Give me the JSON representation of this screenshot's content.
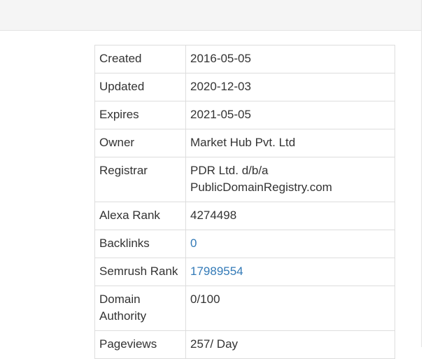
{
  "whois": {
    "rows": [
      {
        "label": "Created",
        "value": "2016-05-05"
      },
      {
        "label": "Updated",
        "value": "2020-12-03"
      },
      {
        "label": "Expires",
        "value": "2021-05-05"
      },
      {
        "label": "Owner",
        "value": "Market Hub Pvt. Ltd"
      },
      {
        "label": "Registrar",
        "value": "PDR Ltd. d/b/a PublicDomainRegistry.com"
      },
      {
        "label": "Alexa Rank",
        "value": "4274498"
      },
      {
        "label": "Backlinks",
        "value": "0"
      },
      {
        "label": "Semrush Rank",
        "value": "17989554"
      },
      {
        "label": "Domain Authority",
        "value": "0/100"
      },
      {
        "label": "Pageviews",
        "value": "257/ Day"
      }
    ]
  },
  "colors": {
    "link": "#337ab7",
    "text": "#333333",
    "border": "#dddddd",
    "header_bg": "#f5f5f5"
  }
}
